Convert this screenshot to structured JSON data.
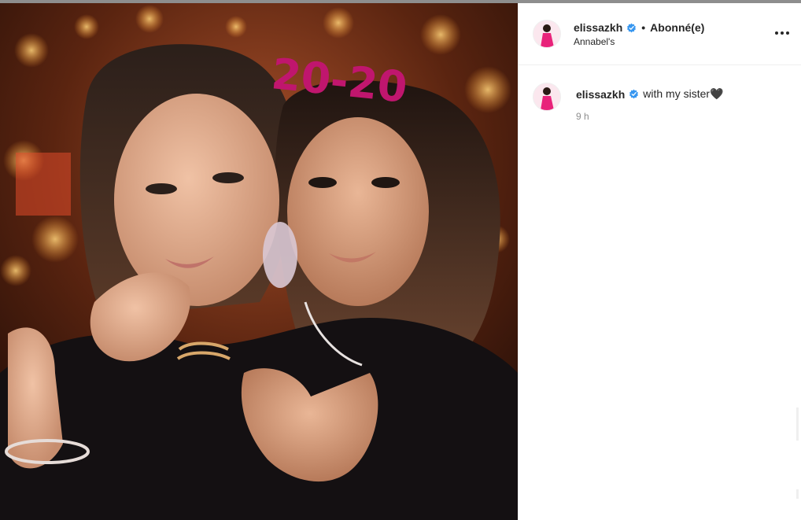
{
  "post": {
    "username": "elissazkh",
    "follow_status": "Abonné(e)",
    "separator": "•",
    "location": "Annabel's",
    "caption": {
      "username": "elissazkh",
      "text": "with my sister🖤",
      "time": "9 h"
    },
    "photo": {
      "headband_text": "20-20"
    }
  },
  "icons": {
    "verified": "verified-badge-icon",
    "more": "more-options-icon"
  },
  "colors": {
    "verified_blue": "#3897f0",
    "text": "#262626",
    "muted": "#8e8e8e",
    "headband_pink": "#c0166e",
    "avatar_dress": "#e8227a"
  }
}
